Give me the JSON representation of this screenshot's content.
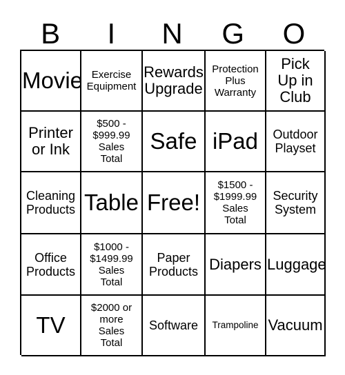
{
  "card": {
    "title": "BINGO Card",
    "header_letters": [
      "B",
      "I",
      "N",
      "G",
      "O"
    ],
    "colors": {
      "background": "#ffffff",
      "text": "#000000",
      "border": "#000000"
    },
    "rows": [
      [
        {
          "text": "Movie",
          "size": "s-xxl"
        },
        {
          "text": "Exercise\nEquipment",
          "size": "s-sm"
        },
        {
          "text": "Rewards\nUpgrade",
          "size": "s-lg"
        },
        {
          "text": "Protection\nPlus\nWarranty",
          "size": "s-sm"
        },
        {
          "text": "Pick\nUp in\nClub",
          "size": "s-lg"
        }
      ],
      [
        {
          "text": "Printer\nor Ink",
          "size": "s-lg"
        },
        {
          "text": "$500 -\n$999.99\nSales\nTotal",
          "size": "s-sm"
        },
        {
          "text": "Safe",
          "size": "s-xxl"
        },
        {
          "text": "iPad",
          "size": "s-xxl"
        },
        {
          "text": "Outdoor\nPlayset",
          "size": "s-md"
        }
      ],
      [
        {
          "text": "Cleaning\nProducts",
          "size": "s-md"
        },
        {
          "text": "Table",
          "size": "s-xxl"
        },
        {
          "text": "Free!",
          "size": "s-xxl"
        },
        {
          "text": "$1500 -\n$1999.99\nSales\nTotal",
          "size": "s-sm"
        },
        {
          "text": "Security\nSystem",
          "size": "s-md"
        }
      ],
      [
        {
          "text": "Office\nProducts",
          "size": "s-md"
        },
        {
          "text": "$1000 -\n$1499.99\nSales\nTotal",
          "size": "s-sm"
        },
        {
          "text": "Paper\nProducts",
          "size": "s-md"
        },
        {
          "text": "Diapers",
          "size": "s-lg"
        },
        {
          "text": "Luggage",
          "size": "s-lg"
        }
      ],
      [
        {
          "text": "TV",
          "size": "s-xxl"
        },
        {
          "text": "$2000 or\nmore\nSales\nTotal",
          "size": "s-sm"
        },
        {
          "text": "Software",
          "size": "s-md"
        },
        {
          "text": "Trampoline",
          "size": "s-xs"
        },
        {
          "text": "Vacuum",
          "size": "s-lg"
        }
      ]
    ]
  }
}
